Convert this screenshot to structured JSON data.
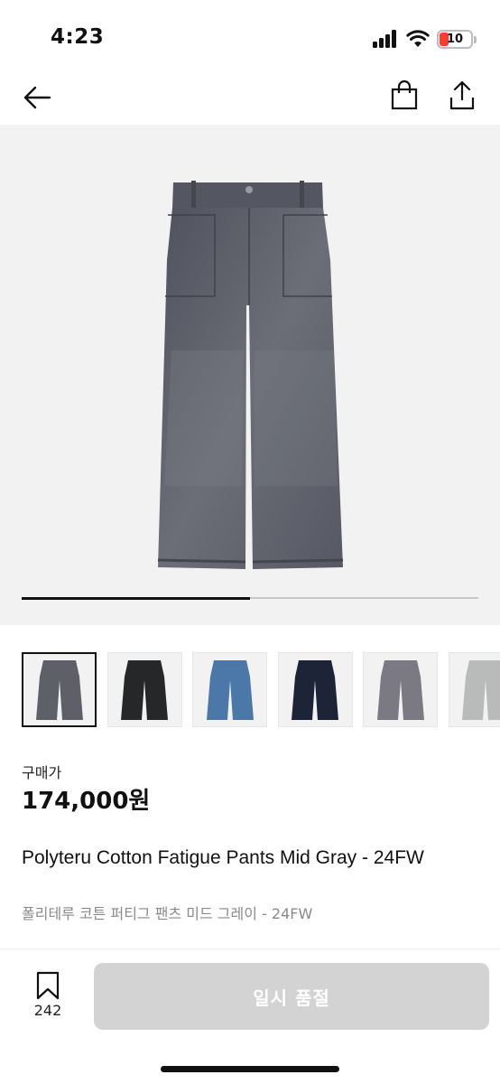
{
  "status_bar": {
    "time": "4:23",
    "battery_level": "10",
    "battery_color": "#ff3b30"
  },
  "nav": {
    "back_icon": "arrow-left-icon",
    "bag_icon": "shopping-bag-icon",
    "share_icon": "share-icon"
  },
  "gallery": {
    "image": "gray-wide-leg-pants",
    "progress": 0.5,
    "thumbnails": [
      {
        "color": "#5e6068",
        "icon": "gray-pants-thumbnail",
        "selected": true
      },
      {
        "color": "#262728",
        "icon": "black-pants-thumbnail",
        "selected": false
      },
      {
        "color": "#4b78a8",
        "icon": "blue-pants-thumbnail",
        "selected": false
      },
      {
        "color": "#1e2438",
        "icon": "navy-pants-thumbnail",
        "selected": false
      },
      {
        "color": "#7b7a82",
        "icon": "light-gray-pants-thumbnail",
        "selected": false
      },
      {
        "color": "#b8bbb9",
        "icon": "pale-gray-pants-thumbnail",
        "selected": false
      }
    ]
  },
  "product": {
    "price_label": "구매가",
    "price": "174,000원",
    "title_en": "Polyteru Cotton Fatigue Pants Mid Gray - 24FW",
    "title_ko": "폴리테루 코튼 퍼티그 팬츠 미드 그레이 - 24FW"
  },
  "bottom_bar": {
    "bookmark_icon": "bookmark-icon",
    "bookmark_count": "242",
    "soldout_label": "일시 품절",
    "button_color": "#d3d3d3"
  }
}
